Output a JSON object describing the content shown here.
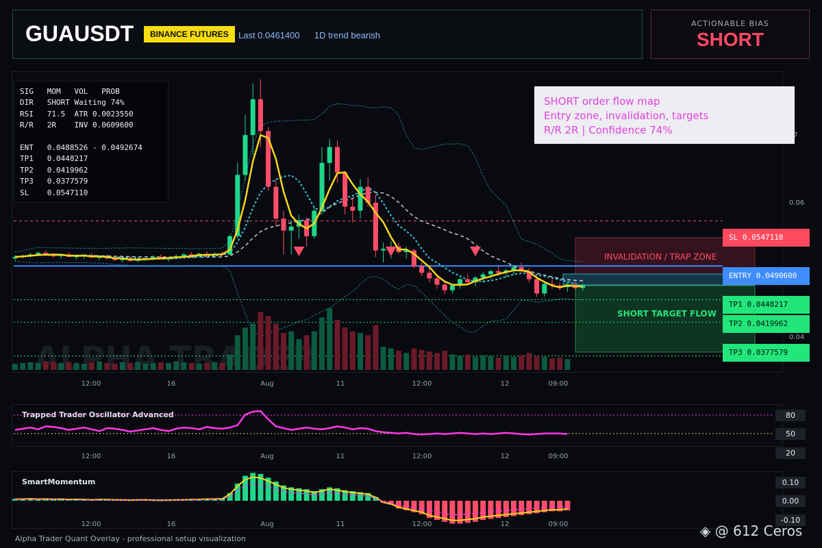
{
  "header": {
    "symbol": "GUAUSDT",
    "exchange": "BINANCE FUTURES",
    "last": "Last 0.0461400",
    "trend": "1D trend bearish"
  },
  "bias": {
    "label": "ACTIONABLE BIAS",
    "value": "SHORT"
  },
  "info_box": {
    "rows": [
      "SIG   MOM   VOL   PROB",
      "DIR   SHORT Waiting 74%",
      "RSI   71.5  ATR 0.0023550",
      "R/R   2R    INV 0.0609600",
      "",
      "ENT   0.0488526 - 0.0492674",
      "TP1   0.0448217",
      "TP2   0.0419962",
      "TP3   0.0377579",
      "SL    0.0547110"
    ]
  },
  "note": {
    "line1": "SHORT order flow map",
    "line2": "Entry zone, invalidation, targets",
    "line3": "R/R 2R | Confidence 74%"
  },
  "levels": {
    "sl": "SL 0.0547110",
    "entry": "ENTRY 0.0490600",
    "tp1": "TP1 0.0448217",
    "tp2": "TP2 0.0419962",
    "tp3": "TP3 0.0377579"
  },
  "zones": {
    "invalidation": "INVALIDATION / TRAP ZONE",
    "target": "SHORT TARGET FLOW"
  },
  "watermark": "ALPHA TRADER",
  "colors": {
    "bull": "#1fd68a",
    "bear": "#ff4d6a",
    "ema": "#f7d51a",
    "sl": "#ff4a5e",
    "entry": "#3f8cff",
    "tp": "#22e67a",
    "osc": "#ff38e8"
  },
  "chart_data": [
    {
      "type": "candlestick",
      "title": "GUAUSDT",
      "x_ticks": [
        "12:00",
        "16",
        "Aug",
        "11",
        "12:00",
        "12",
        "09:00"
      ],
      "y_ticks": [
        "07",
        "0.06",
        "0.04"
      ],
      "ylim": [
        0.036,
        0.073
      ],
      "levels": {
        "sl": 0.054711,
        "entry": 0.04906,
        "tp1": 0.0448217,
        "tp2": 0.0419962,
        "tp3": 0.0377579
      },
      "ohlc": [
        [
          0.05,
          0.0504,
          0.0497,
          0.0502
        ],
        [
          0.0502,
          0.0505,
          0.05,
          0.0503
        ],
        [
          0.0503,
          0.0507,
          0.0501,
          0.0505
        ],
        [
          0.0505,
          0.0509,
          0.0503,
          0.0507
        ],
        [
          0.0507,
          0.051,
          0.0504,
          0.0504
        ],
        [
          0.0504,
          0.0507,
          0.0501,
          0.0503
        ],
        [
          0.0503,
          0.0506,
          0.05,
          0.0505
        ],
        [
          0.0505,
          0.0508,
          0.0502,
          0.0502
        ],
        [
          0.0502,
          0.0505,
          0.0499,
          0.0503
        ],
        [
          0.0503,
          0.0506,
          0.05,
          0.0504
        ],
        [
          0.0504,
          0.0507,
          0.0501,
          0.0501
        ],
        [
          0.0501,
          0.0504,
          0.0498,
          0.0502
        ],
        [
          0.0502,
          0.0505,
          0.0499,
          0.05
        ],
        [
          0.05,
          0.0503,
          0.0497,
          0.0498
        ],
        [
          0.0498,
          0.0501,
          0.0495,
          0.05
        ],
        [
          0.05,
          0.0503,
          0.0496,
          0.0497
        ],
        [
          0.0497,
          0.0501,
          0.0495,
          0.0499
        ],
        [
          0.0499,
          0.0502,
          0.0497,
          0.05
        ],
        [
          0.05,
          0.0504,
          0.0498,
          0.0502
        ],
        [
          0.0502,
          0.0505,
          0.0499,
          0.0499
        ],
        [
          0.0499,
          0.0502,
          0.0496,
          0.0501
        ],
        [
          0.0501,
          0.0505,
          0.0499,
          0.0503
        ],
        [
          0.0503,
          0.0507,
          0.0501,
          0.0505
        ],
        [
          0.0505,
          0.0508,
          0.0502,
          0.0503
        ],
        [
          0.0503,
          0.0507,
          0.0501,
          0.0506
        ],
        [
          0.0506,
          0.0509,
          0.0503,
          0.0504
        ],
        [
          0.0504,
          0.0508,
          0.0502,
          0.0506
        ],
        [
          0.0506,
          0.0509,
          0.0503,
          0.0505
        ],
        [
          0.0505,
          0.053,
          0.0504,
          0.0528
        ],
        [
          0.0528,
          0.062,
          0.0525,
          0.0605
        ],
        [
          0.0605,
          0.068,
          0.0598,
          0.0655
        ],
        [
          0.0655,
          0.072,
          0.063,
          0.07
        ],
        [
          0.07,
          0.0725,
          0.064,
          0.066
        ],
        [
          0.066,
          0.0665,
          0.0585,
          0.059
        ],
        [
          0.059,
          0.06,
          0.054,
          0.055
        ],
        [
          0.055,
          0.056,
          0.0505,
          0.0535
        ],
        [
          0.0535,
          0.0548,
          0.0505,
          0.054
        ],
        [
          0.054,
          0.0555,
          0.0525,
          0.0548
        ],
        [
          0.0548,
          0.0552,
          0.0515,
          0.0528
        ],
        [
          0.0528,
          0.0565,
          0.0525,
          0.056
        ],
        [
          0.056,
          0.064,
          0.0555,
          0.062
        ],
        [
          0.062,
          0.065,
          0.0598,
          0.064
        ],
        [
          0.064,
          0.0648,
          0.0595,
          0.0608
        ],
        [
          0.0608,
          0.061,
          0.0555,
          0.0565
        ],
        [
          0.0565,
          0.0575,
          0.0545,
          0.056
        ],
        [
          0.056,
          0.06,
          0.055,
          0.059
        ],
        [
          0.059,
          0.0602,
          0.0565,
          0.057
        ],
        [
          0.057,
          0.058,
          0.0502,
          0.051
        ],
        [
          0.051,
          0.052,
          0.0495,
          0.0512
        ],
        [
          0.0512,
          0.0522,
          0.05,
          0.0515
        ],
        [
          0.0515,
          0.052,
          0.0506,
          0.0508
        ],
        [
          0.0508,
          0.0515,
          0.05,
          0.051
        ],
        [
          0.051,
          0.0512,
          0.0488,
          0.049
        ],
        [
          0.049,
          0.0495,
          0.0478,
          0.0482
        ],
        [
          0.0482,
          0.0488,
          0.047,
          0.0475
        ],
        [
          0.0475,
          0.0478,
          0.0462,
          0.0467
        ],
        [
          0.0467,
          0.047,
          0.0455,
          0.046
        ],
        [
          0.046,
          0.0468,
          0.0456,
          0.0466
        ],
        [
          0.0466,
          0.0476,
          0.0462,
          0.0474
        ],
        [
          0.0474,
          0.048,
          0.0466,
          0.047
        ],
        [
          0.047,
          0.0478,
          0.0465,
          0.0476
        ],
        [
          0.0476,
          0.0483,
          0.047,
          0.048
        ],
        [
          0.048,
          0.0486,
          0.0474,
          0.0484
        ],
        [
          0.0484,
          0.049,
          0.0478,
          0.0482
        ],
        [
          0.0482,
          0.0487,
          0.0476,
          0.0485
        ],
        [
          0.0485,
          0.0492,
          0.048,
          0.0489
        ],
        [
          0.0489,
          0.0495,
          0.0482,
          0.0484
        ],
        [
          0.0484,
          0.0488,
          0.047,
          0.0474
        ],
        [
          0.0474,
          0.0478,
          0.0452,
          0.0456
        ],
        [
          0.0456,
          0.047,
          0.0452,
          0.0468
        ],
        [
          0.0468,
          0.0474,
          0.0462,
          0.0466
        ],
        [
          0.0466,
          0.047,
          0.046,
          0.0464
        ],
        [
          0.0464,
          0.047,
          0.0458,
          0.0467
        ],
        [
          0.0467,
          0.0471,
          0.0461,
          0.0463
        ],
        [
          0.0463,
          0.0468,
          0.0459,
          0.0466
        ]
      ],
      "volume": [
        8,
        9,
        10,
        9,
        11,
        10,
        9,
        10,
        9,
        8,
        10,
        11,
        9,
        8,
        10,
        9,
        10,
        8,
        9,
        10,
        9,
        11,
        10,
        9,
        8,
        9,
        10,
        9,
        20,
        45,
        55,
        60,
        75,
        70,
        60,
        48,
        50,
        40,
        45,
        50,
        68,
        80,
        65,
        55,
        50,
        48,
        45,
        58,
        30,
        28,
        25,
        22,
        28,
        26,
        24,
        22,
        25,
        20,
        18,
        20,
        17,
        19,
        18,
        16,
        18,
        17,
        19,
        22,
        18,
        17,
        15,
        16,
        14
      ]
    },
    {
      "type": "line",
      "title": "Trapped Trader Oscillator Advanced",
      "y_ticks": [
        "80",
        "50",
        "20"
      ],
      "values": [
        52,
        54,
        56,
        53,
        58,
        57,
        55,
        52,
        54,
        56,
        53,
        50,
        55,
        54,
        52,
        49,
        51,
        53,
        55,
        52,
        50,
        54,
        56,
        55,
        53,
        57,
        55,
        54,
        56,
        60,
        78,
        83,
        84,
        70,
        58,
        55,
        52,
        54,
        56,
        54,
        53,
        55,
        58,
        56,
        53,
        55,
        54,
        50,
        48,
        47,
        46,
        47,
        45,
        44,
        45,
        46,
        45,
        46,
        47,
        46,
        45,
        46,
        45,
        46,
        47,
        46,
        45,
        44,
        45,
        46,
        46,
        46,
        45
      ]
    },
    {
      "type": "line",
      "title": "SmartMomentum",
      "y_ticks": [
        "0.10",
        "0.00",
        "-0.10"
      ],
      "values": [
        0.01,
        0.01,
        0.012,
        0.01,
        0.011,
        0.009,
        0.01,
        0.008,
        0.009,
        0.007,
        0.006,
        0.008,
        0.007,
        0.006,
        0.005,
        0.004,
        0.005,
        0.006,
        0.004,
        0.003,
        0.004,
        0.005,
        0.006,
        0.007,
        0.008,
        0.01,
        0.011,
        0.012,
        0.04,
        0.09,
        0.13,
        0.145,
        0.14,
        0.12,
        0.1,
        0.08,
        0.07,
        0.065,
        0.06,
        0.05,
        0.06,
        0.07,
        0.065,
        0.055,
        0.05,
        0.045,
        0.04,
        0.02,
        -0.01,
        -0.02,
        -0.04,
        -0.05,
        -0.06,
        -0.07,
        -0.09,
        -0.1,
        -0.11,
        -0.12,
        -0.12,
        -0.115,
        -0.11,
        -0.1,
        -0.095,
        -0.09,
        -0.085,
        -0.08,
        -0.075,
        -0.07,
        -0.065,
        -0.06,
        -0.055,
        -0.055,
        -0.05
      ]
    }
  ]
}
